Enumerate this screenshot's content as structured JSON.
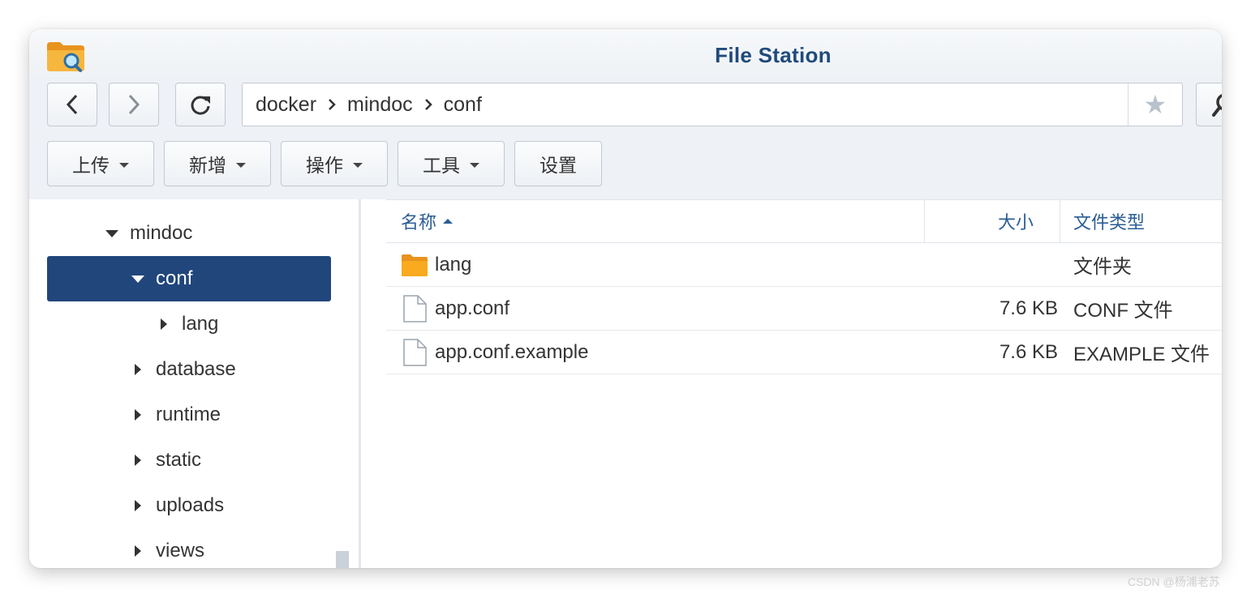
{
  "app": {
    "title": "File Station",
    "icon": "file-station-icon"
  },
  "nav": {
    "back_icon": "chevron-left-icon",
    "forward_icon": "chevron-right-icon",
    "refresh_icon": "refresh-icon",
    "search_icon": "search-icon",
    "favorite_icon": "star-icon",
    "favorite_glyph": "★"
  },
  "path": {
    "segments": [
      "docker",
      "mindoc",
      "conf"
    ]
  },
  "toolbar": {
    "upload_label": "上传",
    "create_label": "新增",
    "action_label": "操作",
    "tools_label": "工具",
    "settings_label": "设置"
  },
  "tree": {
    "items": [
      {
        "label": "mindoc",
        "expanded": true,
        "selected": false
      },
      {
        "label": "conf",
        "expanded": true,
        "selected": true
      },
      {
        "label": "lang",
        "expanded": false,
        "selected": false
      },
      {
        "label": "database",
        "expanded": false,
        "selected": false
      },
      {
        "label": "runtime",
        "expanded": false,
        "selected": false
      },
      {
        "label": "static",
        "expanded": false,
        "selected": false
      },
      {
        "label": "uploads",
        "expanded": false,
        "selected": false
      },
      {
        "label": "views",
        "expanded": false,
        "selected": false
      }
    ]
  },
  "list": {
    "columns": {
      "name": "名称",
      "size": "大小",
      "type": "文件类型"
    },
    "sort": "name-ascending",
    "rows": [
      {
        "name": "lang",
        "size": "",
        "type": "文件夹",
        "icon": "folder-icon"
      },
      {
        "name": "app.conf",
        "size": "7.6 KB",
        "type": "CONF 文件",
        "icon": "file-icon"
      },
      {
        "name": "app.conf.example",
        "size": "7.6 KB",
        "type": "EXAMPLE 文件",
        "icon": "file-icon"
      }
    ]
  },
  "colors": {
    "accent": "#21467c",
    "title": "#1f4a7c",
    "header_text": "#2b5d95",
    "folder": "#f6a623"
  },
  "watermark": "CSDN @杨浦老苏"
}
